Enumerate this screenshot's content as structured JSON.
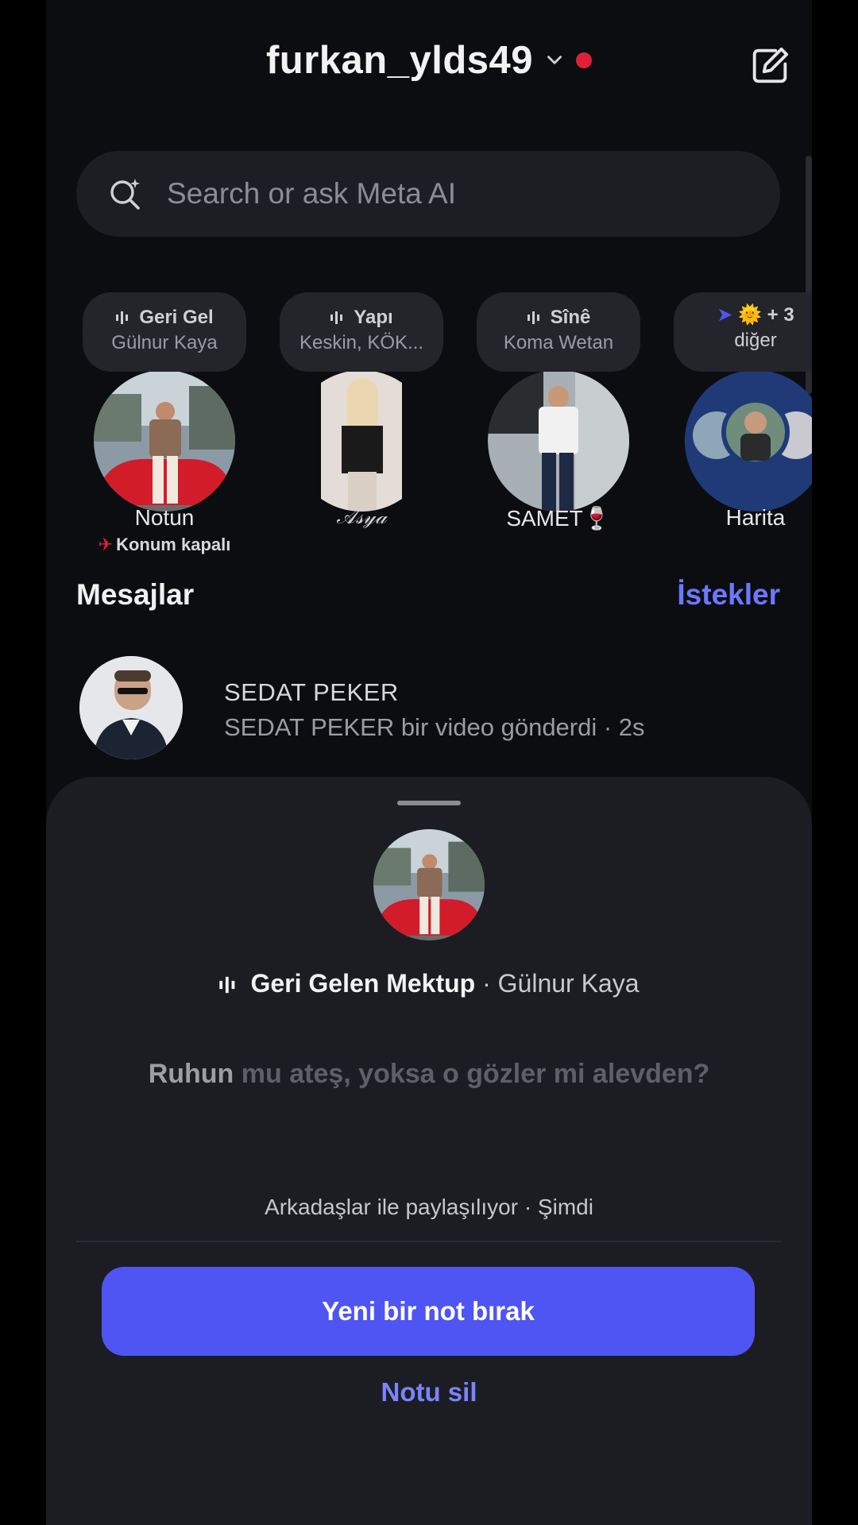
{
  "header": {
    "username": "furkan_ylds49"
  },
  "search": {
    "placeholder": "Search or ask Meta AI"
  },
  "notes": [
    {
      "bubble_line1": "Geri Gel",
      "bubble_line2": "Gülnur Kaya",
      "name": "Notun",
      "subtitle": "Konum kapalı"
    },
    {
      "bubble_line1": "Yapı",
      "bubble_line2": "Keskin, KÖK...",
      "name": "𝒜𝓈𝓎𝒶"
    },
    {
      "bubble_line1": "Sînê",
      "bubble_line2": "Koma Wetan",
      "name": "SAMET🍷"
    },
    {
      "bubble_line1": "+ 3",
      "bubble_line2": "diğer",
      "name": "Harita"
    }
  ],
  "messages": {
    "title": "Mesajlar",
    "requests_label": "İstekler",
    "items": [
      {
        "name": "SEDAT PEKER",
        "preview": "SEDAT PEKER bir video gönderdi · 2s"
      }
    ]
  },
  "sheet": {
    "song_title": "Geri Gelen Mektup",
    "song_artist": " · Gülnur Kaya",
    "quote_highlight": "Ruhun",
    "quote_rest": " mu ateş, yoksa o gözler mi alevden?",
    "shared_text": "Arkadaşlar ile paylaşılıyor · Şimdi",
    "primary_button": "Yeni bir not bırak",
    "delete_button": "Notu sil"
  },
  "colors": {
    "accent": "#4f55f2",
    "link": "#6d78ff",
    "status_dot": "#e0203b"
  }
}
